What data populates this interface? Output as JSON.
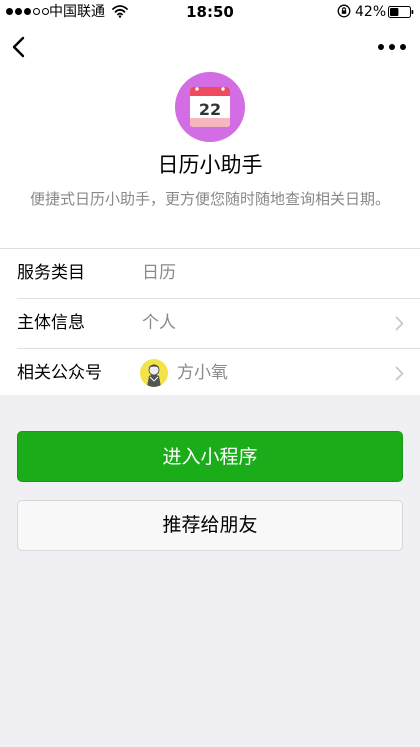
{
  "status_bar": {
    "carrier": "中国联通",
    "time": "18:50",
    "battery": "42%"
  },
  "nav": {
    "back_icon": "chevron-left-icon",
    "more_icon": "more-dots-icon"
  },
  "app": {
    "icon_day": "22",
    "name": "日历小助手",
    "description": "便捷式日历小助手，更方便您随时随地查询相关日期。"
  },
  "info": {
    "rows": [
      {
        "label": "服务类目",
        "value": "日历"
      },
      {
        "label": "主体信息",
        "value": "个人"
      },
      {
        "label": "相关公众号",
        "value": "方小氧"
      }
    ]
  },
  "actions": {
    "enter_label": "进入小程序",
    "share_label": "推荐给朋友"
  },
  "colors": {
    "accent_green": "#1aad19",
    "icon_bg": "#d36de3",
    "calendar_red": "#f04a5e",
    "secondary_text": "#888888"
  }
}
